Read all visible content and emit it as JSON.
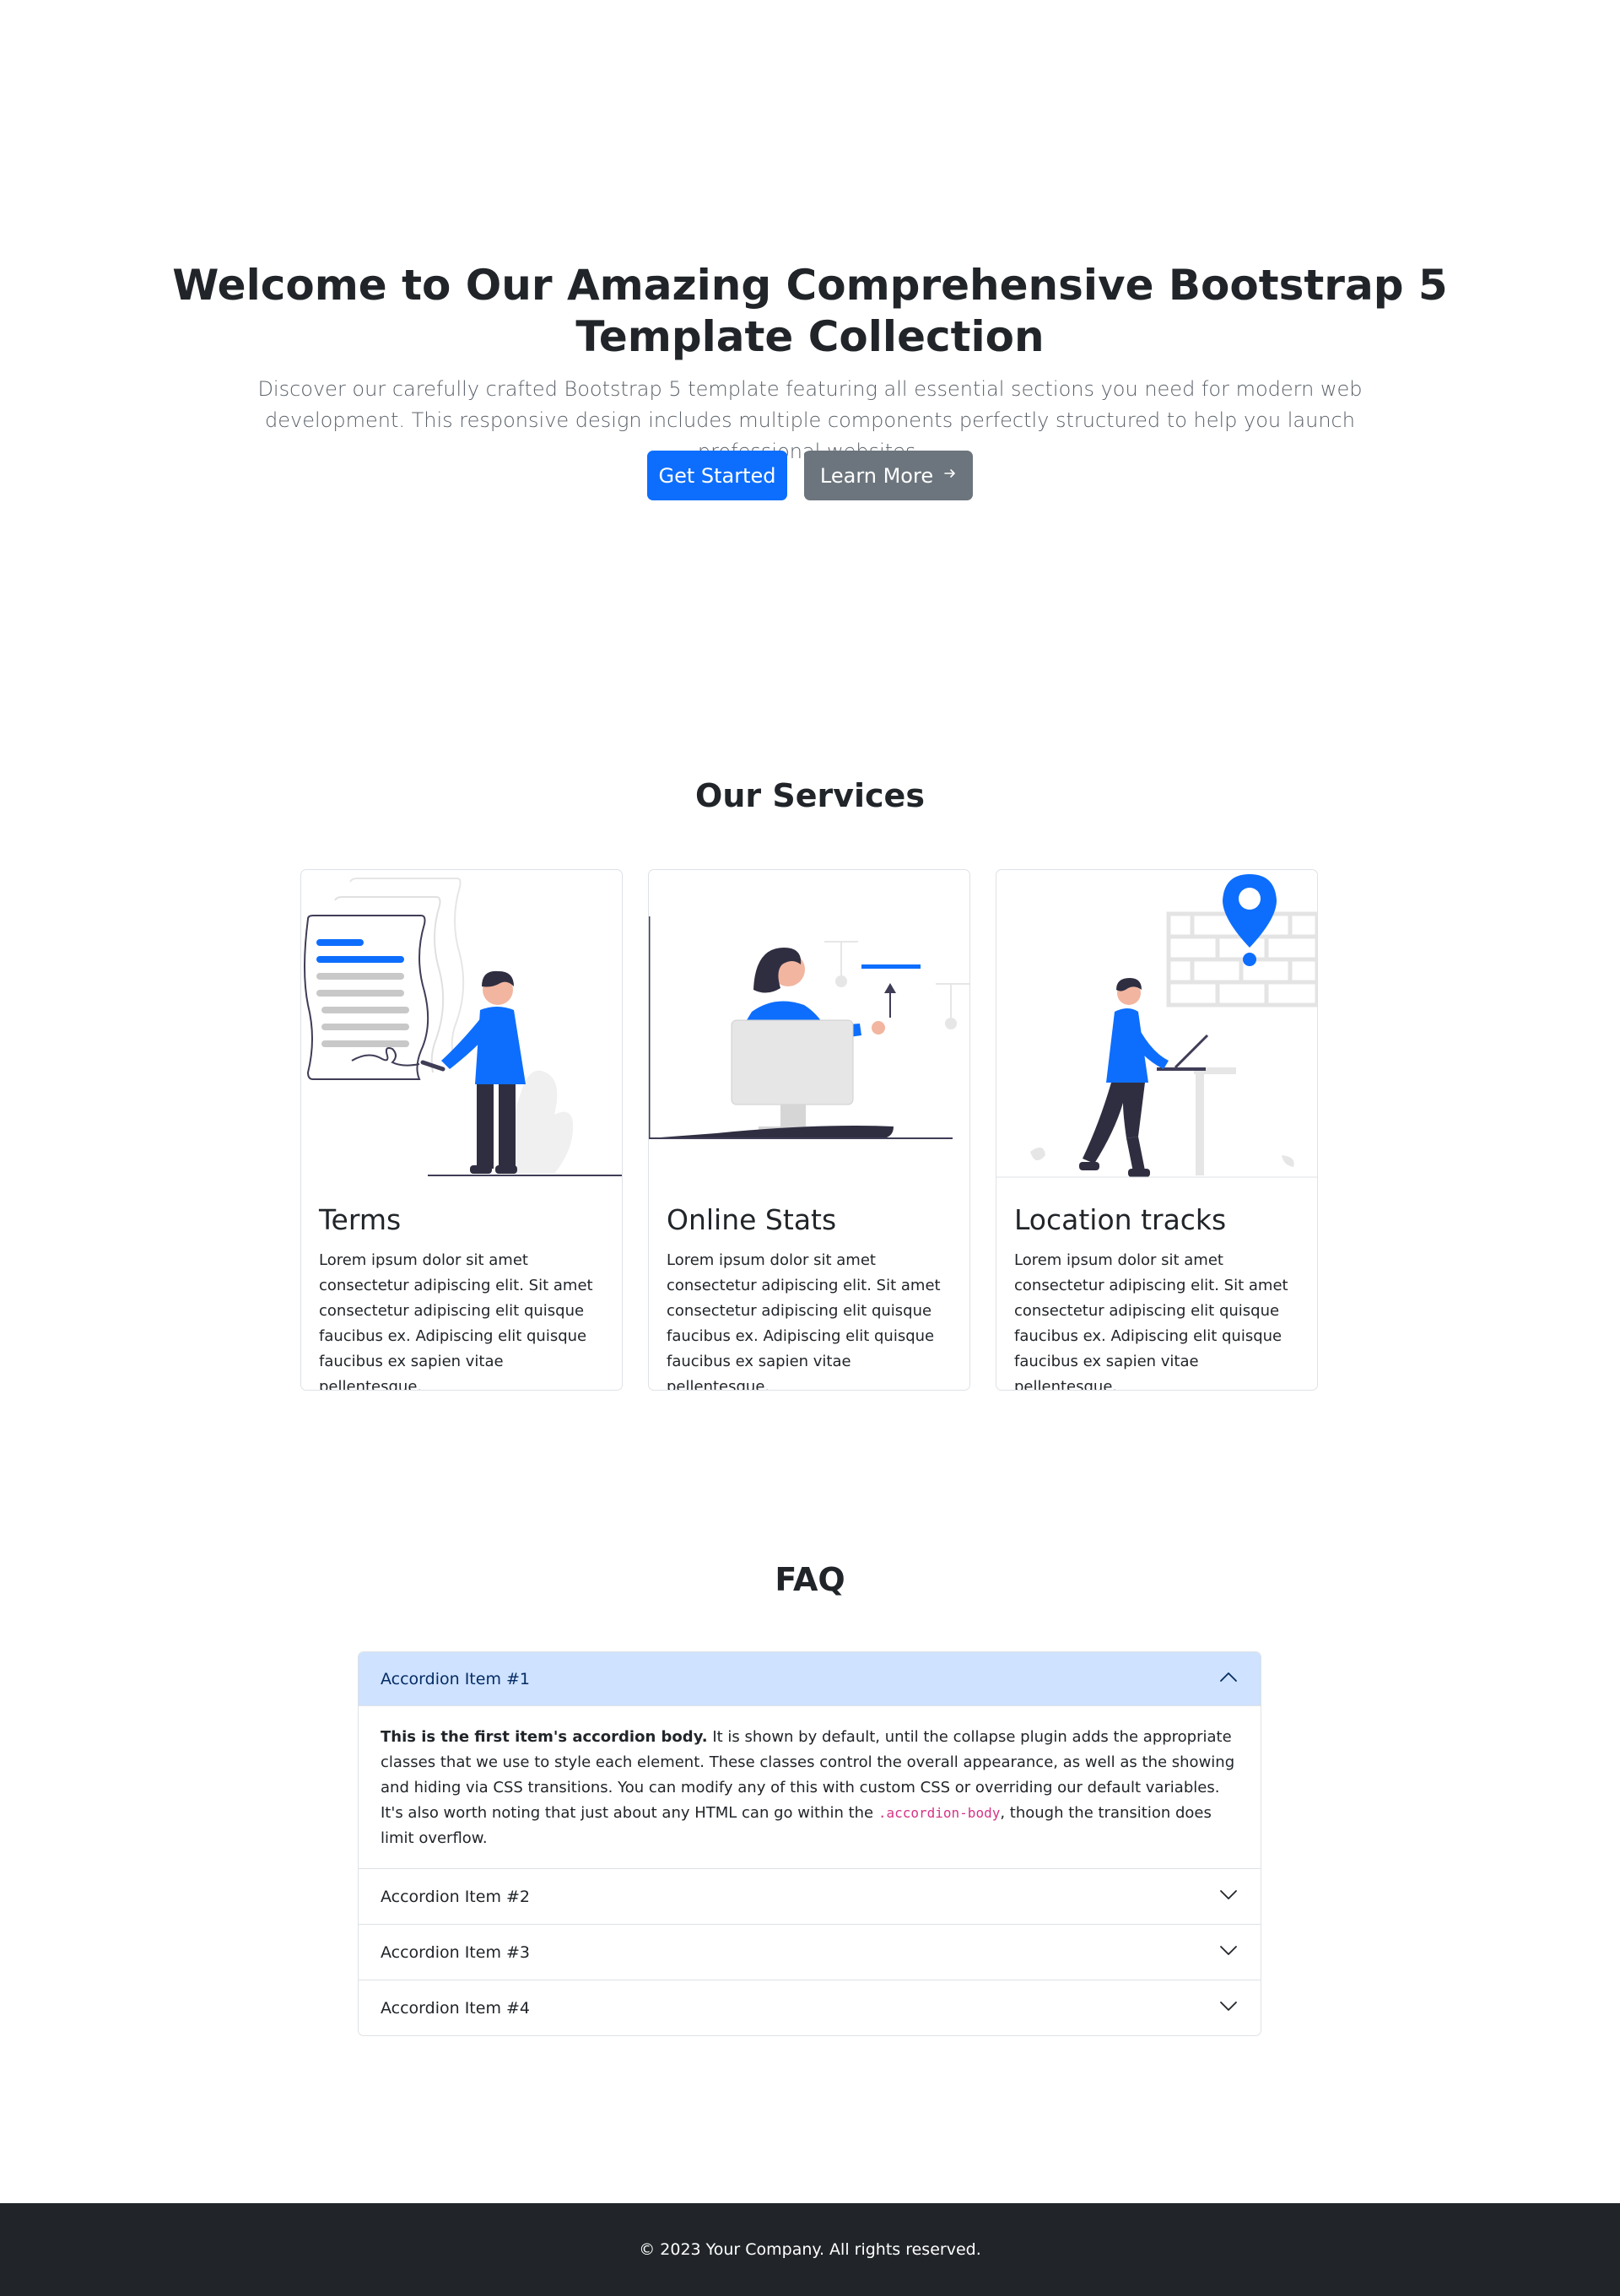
{
  "hero": {
    "title": "Welcome to Our Amazing Comprehensive Bootstrap 5 Template Collection",
    "subtitle": "Discover our carefully crafted Bootstrap 5 template featuring all essential sections you need for modern web development. This responsive design includes multiple components perfectly structured to help you launch professional websites.",
    "primary_button": "Get Started",
    "secondary_button": "Learn More",
    "secondary_icon": "arrow-right-icon"
  },
  "services": {
    "title": "Our Services",
    "cards": [
      {
        "title": "Terms",
        "text": "Lorem ipsum dolor sit amet consectetur adipiscing elit. Sit amet consectetur adipiscing elit quisque faucibus ex. Adipiscing elit quisque faucibus ex sapien vitae pellentesque.",
        "icon": "signing-document-illustration"
      },
      {
        "title": "Online Stats",
        "text": "Lorem ipsum dolor sit amet consectetur adipiscing elit. Sit amet consectetur adipiscing elit quisque faucibus ex. Adipiscing elit quisque faucibus ex sapien vitae pellentesque.",
        "icon": "computer-stats-illustration"
      },
      {
        "title": "Location tracks",
        "text": "Lorem ipsum dolor sit amet consectetur adipiscing elit. Sit amet consectetur adipiscing elit quisque faucibus ex. Adipiscing elit quisque faucibus ex sapien vitae pellentesque.",
        "icon": "map-pin-illustration"
      }
    ]
  },
  "faq": {
    "title": "FAQ",
    "items": [
      {
        "label": "Accordion Item #1",
        "open": true
      },
      {
        "label": "Accordion Item #2",
        "open": false
      },
      {
        "label": "Accordion Item #3",
        "open": false
      },
      {
        "label": "Accordion Item #4",
        "open": false
      }
    ],
    "body": {
      "bold": "This is the first item's accordion body.",
      "text_before_code": " It is shown by default, until the collapse plugin adds the appropriate classes that we use to style each element. These classes control the overall appearance, as well as the showing and hiding via CSS transitions. You can modify any of this with custom CSS or overriding our default variables. It's also worth noting that just about any HTML can go within the ",
      "code": ".accordion-body",
      "text_after_code": ", though the transition does limit overflow."
    }
  },
  "footer": {
    "text": "© 2023 Your Company. All rights reserved."
  },
  "colors": {
    "primary": "#0d6efd",
    "secondary": "#6c757d",
    "accordion_active": "#cfe2ff",
    "footer_bg": "#212529",
    "code": "#d63384"
  }
}
